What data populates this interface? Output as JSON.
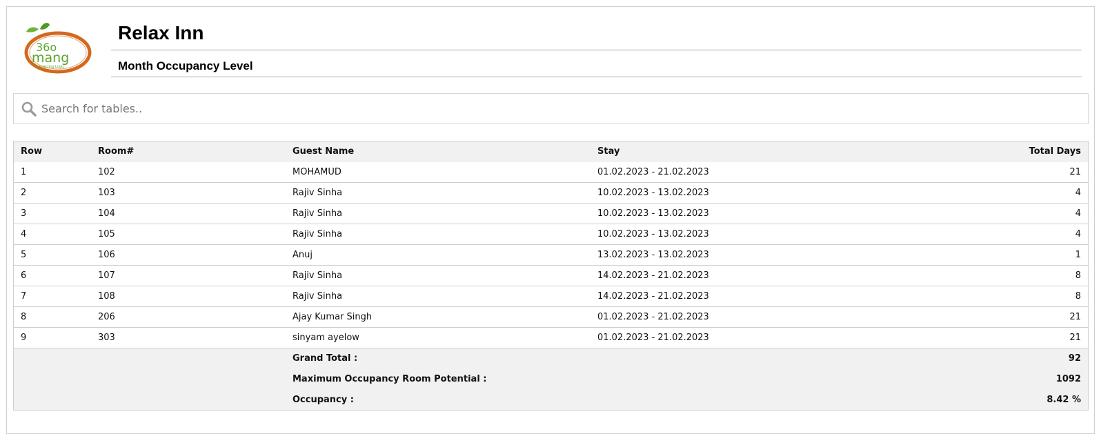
{
  "header": {
    "logo_alt": "360 mang connecting logic",
    "hotel_name": "Relax Inn",
    "report_title": "Month Occupancy Level"
  },
  "search": {
    "placeholder": "Search for tables.."
  },
  "table": {
    "columns": [
      "Row",
      "Room#",
      "Guest Name",
      "Stay",
      "Total Days"
    ],
    "rows": [
      {
        "row": "1",
        "room": "102",
        "guest": "MOHAMUD",
        "stay": "01.02.2023 - 21.02.2023",
        "days": "21"
      },
      {
        "row": "2",
        "room": "103",
        "guest": "Rajiv Sinha",
        "stay": "10.02.2023 - 13.02.2023",
        "days": "4"
      },
      {
        "row": "3",
        "room": "104",
        "guest": "Rajiv Sinha",
        "stay": "10.02.2023 - 13.02.2023",
        "days": "4"
      },
      {
        "row": "4",
        "room": "105",
        "guest": "Rajiv Sinha",
        "stay": "10.02.2023 - 13.02.2023",
        "days": "4"
      },
      {
        "row": "5",
        "room": "106",
        "guest": "Anuj",
        "stay": "13.02.2023 - 13.02.2023",
        "days": "1"
      },
      {
        "row": "6",
        "room": "107",
        "guest": "Rajiv Sinha",
        "stay": "14.02.2023 - 21.02.2023",
        "days": "8"
      },
      {
        "row": "7",
        "room": "108",
        "guest": "Rajiv Sinha",
        "stay": "14.02.2023 - 21.02.2023",
        "days": "8"
      },
      {
        "row": "8",
        "room": "206",
        "guest": "Ajay Kumar Singh",
        "stay": "01.02.2023 - 21.02.2023",
        "days": "21"
      },
      {
        "row": "9",
        "room": "303",
        "guest": "sinyam ayelow",
        "stay": "01.02.2023 - 21.02.2023",
        "days": "21"
      }
    ],
    "summary": [
      {
        "label": "Grand Total :",
        "value": "92"
      },
      {
        "label": "Maximum Occupancy Room Potential :",
        "value": "1092"
      },
      {
        "label": "Occupancy :",
        "value": "8.42 %"
      }
    ]
  },
  "colors": {
    "logo_ring": "#d2691e",
    "logo_leaf": "#5aa52a",
    "header_bg": "#f1f1f1",
    "border": "#cfcfcf"
  }
}
